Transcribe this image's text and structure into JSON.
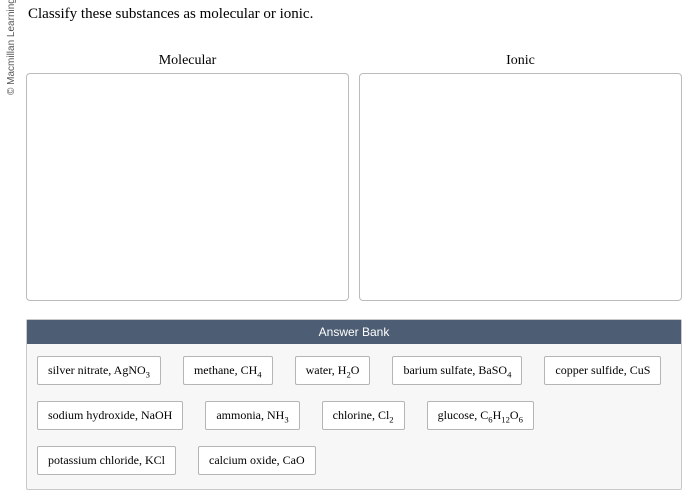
{
  "copyright": "© Macmillan Learning",
  "question": "Classify these substances as molecular or ionic.",
  "categories": [
    {
      "label": "Molecular"
    },
    {
      "label": "Ionic"
    }
  ],
  "bank": {
    "header": "Answer Bank",
    "items": [
      {
        "name": "silver-nitrate",
        "text": "silver nitrate, AgNO",
        "sub": "3"
      },
      {
        "name": "methane",
        "text": "methane, CH",
        "sub": "4"
      },
      {
        "name": "water",
        "prefix": "water, H",
        "mid_sub": "2",
        "suffix": "O"
      },
      {
        "name": "barium-sulfate",
        "text": "barium sulfate, BaSO",
        "sub": "4"
      },
      {
        "name": "copper-sulfide",
        "text": "copper sulfide, CuS"
      },
      {
        "name": "sodium-hydroxide",
        "text": "sodium hydroxide, NaOH"
      },
      {
        "name": "ammonia",
        "text": "ammonia, NH",
        "sub": "3"
      },
      {
        "name": "chlorine",
        "text": "chlorine, Cl",
        "sub": "2"
      },
      {
        "name": "glucose",
        "glucose": true,
        "p1": "glucose, C",
        "s1": "6",
        "p2": "H",
        "s2": "12",
        "p3": "O",
        "s3": "6"
      },
      {
        "name": "potassium-chloride",
        "text": "potassium chloride, KCl"
      },
      {
        "name": "calcium-oxide",
        "text": "calcium oxide, CaO"
      }
    ]
  }
}
